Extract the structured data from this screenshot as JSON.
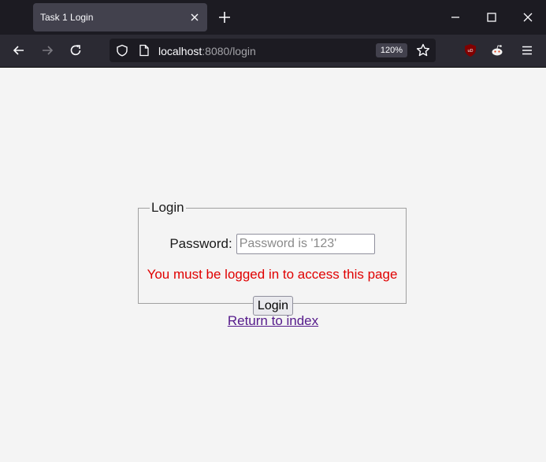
{
  "browser": {
    "tab": {
      "title": "Task 1 Login"
    },
    "url": {
      "host": "localhost",
      "rest": ":8080/login"
    },
    "zoom": "120%"
  },
  "page": {
    "legend": "Login",
    "password_label": "Password:",
    "password_placeholder": "Password is '123'",
    "error_message": "You must be logged in to access this page",
    "login_button": "Login",
    "return_link": "Return to index"
  },
  "colors": {
    "error": "#e00000",
    "visited_link": "#551a8b"
  }
}
